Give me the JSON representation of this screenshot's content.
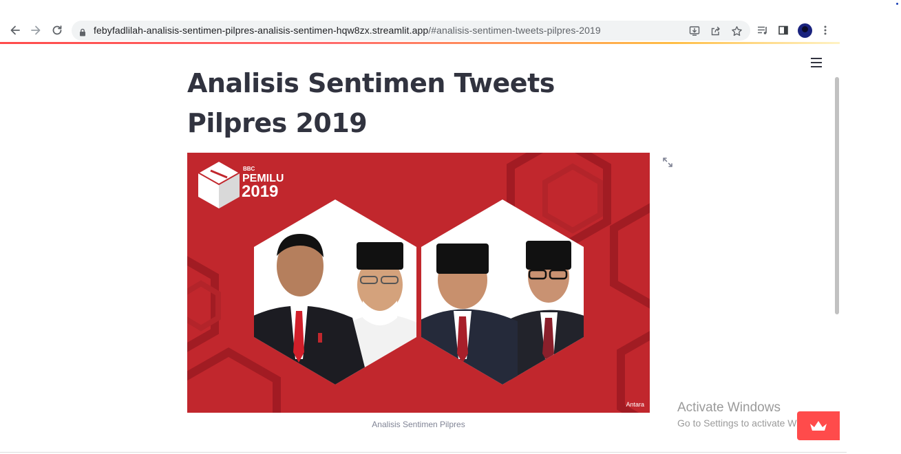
{
  "browser": {
    "url_host": "febyfadlilah-analisis-sentimen-pilpres-analisis-sentimen-hqw8zx.streamlit.app",
    "url_path": "/#analisis-sentimen-tweets-pilpres-2019",
    "icons": [
      "back-icon",
      "forward-icon",
      "reload-icon",
      "lock-icon",
      "install-app-icon",
      "share-icon",
      "bookmark-star-icon",
      "media-queue-icon",
      "side-panel-icon",
      "profile-avatar",
      "more-menu-icon"
    ]
  },
  "page": {
    "title": "Analisis Sentimen Tweets Pilpres 2019",
    "image": {
      "brand_small": "BBC",
      "brand_main": "PEMILU",
      "brand_year": "2019",
      "credit": "Antara",
      "caption": "Analisis Sentimen Pilpres"
    }
  },
  "windows_watermark": {
    "line1": "Activate Windows",
    "line2": "Go to Settings to activate Windows."
  },
  "colors": {
    "accent": "#ff4b4b",
    "banner_red": "#c1272d",
    "title_text": "#31333f"
  }
}
